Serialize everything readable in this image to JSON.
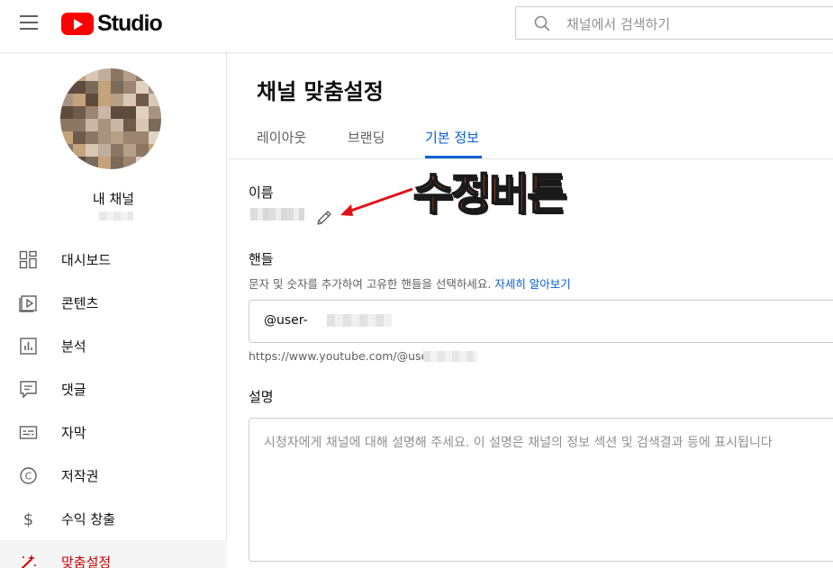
{
  "header": {
    "logo_text": "Studio",
    "search_placeholder": "채널에서 검색하기"
  },
  "sidebar": {
    "channel_name": "내 채널",
    "items": [
      {
        "label": "대시보드",
        "icon": "dashboard-icon"
      },
      {
        "label": "콘텐츠",
        "icon": "content-icon"
      },
      {
        "label": "분석",
        "icon": "analytics-icon"
      },
      {
        "label": "댓글",
        "icon": "comments-icon"
      },
      {
        "label": "자막",
        "icon": "subtitles-icon"
      },
      {
        "label": "저작권",
        "icon": "copyright-icon"
      },
      {
        "label": "수익 창출",
        "icon": "monetization-icon"
      },
      {
        "label": "맞춤설정",
        "icon": "customization-icon",
        "active": true
      }
    ]
  },
  "main": {
    "title": "채널 맞춤설정",
    "tabs": [
      {
        "label": "레이아웃"
      },
      {
        "label": "브랜딩"
      },
      {
        "label": "기본 정보",
        "active": true
      }
    ],
    "name_label": "이름",
    "handle_label": "핸들",
    "handle_help": "문자 및 숫자를 추가하여 고유한 핸들을 선택하세요.",
    "handle_help_link": "자세히 알아보기",
    "handle_value": "@user-",
    "handle_url": "https://www.youtube.com/@user-",
    "description_label": "설명",
    "description_placeholder": "시청자에게 채널에 대해 설명해 주세요. 이 설명은 채널의 정보 섹션 및 검색결과 등에 표시됩니다"
  },
  "annotation": {
    "text": "수정버튼",
    "color": "#ff5a1f",
    "arrow_color": "#e0101a"
  },
  "colors": {
    "accent_blue": "#065fd4",
    "active_red": "#cc0000",
    "brand_red": "#ff0000"
  }
}
